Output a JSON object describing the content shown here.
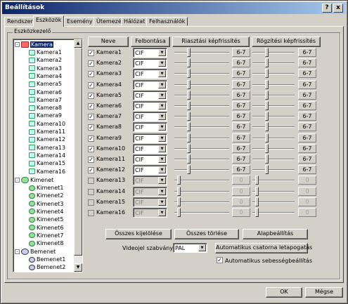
{
  "window": {
    "title": "Beállítások",
    "help_label": "?",
    "close_label": "x"
  },
  "tabs": [
    "Rendszer",
    "Eszközök",
    "Esemény",
    "Ütemezés",
    "Hálózat",
    "Felhasználók"
  ],
  "group_label": "Eszközkezelő",
  "tree": {
    "root": "Kamera",
    "cameras": [
      "Kamera1",
      "Kamera2",
      "Kamera3",
      "Kamera4",
      "Kamera5",
      "Kamera6",
      "Kamera7",
      "Kamera8",
      "Kamera9",
      "Kamera10",
      "Kamera11",
      "Kamera12",
      "Kamera13",
      "Kamera14",
      "Kamera15",
      "Kamera16"
    ],
    "outputs_root": "Kimenet",
    "outputs": [
      "Kimenet1",
      "Kimenet2",
      "Kimenet3",
      "Kimenet4",
      "Kimenet5",
      "Kimenet6",
      "Kimenet7",
      "Kimenet8"
    ],
    "inputs_root": "Bemenet",
    "inputs": [
      "Bemenet1",
      "Bemenet2"
    ]
  },
  "headers": {
    "name": "Neve",
    "resolution": "Felbontása",
    "alarm_rate": "Riasztási képfrissítés",
    "record_rate": "Rögzítési képfrissítés"
  },
  "cameras": [
    {
      "name": "Kamera1",
      "checked": true,
      "res": "CIF",
      "alarm": "6-7",
      "record": "6-7"
    },
    {
      "name": "Kamera2",
      "checked": true,
      "res": "CIF",
      "alarm": "6-7",
      "record": "6-7"
    },
    {
      "name": "Kamera3",
      "checked": true,
      "res": "CIF",
      "alarm": "6-7",
      "record": "6-7"
    },
    {
      "name": "Kamera4",
      "checked": true,
      "res": "CIF",
      "alarm": "6-7",
      "record": "6-7"
    },
    {
      "name": "Kamera5",
      "checked": true,
      "res": "CIF",
      "alarm": "6-7",
      "record": "6-7"
    },
    {
      "name": "Kamera6",
      "checked": true,
      "res": "CIF",
      "alarm": "6-7",
      "record": "6-7"
    },
    {
      "name": "Kamera7",
      "checked": true,
      "res": "CIF",
      "alarm": "6-7",
      "record": "6-7"
    },
    {
      "name": "Kamera8",
      "checked": true,
      "res": "CIF",
      "alarm": "6-7",
      "record": "6-7"
    },
    {
      "name": "Kamera9",
      "checked": true,
      "res": "CIF",
      "alarm": "6-7",
      "record": "6-7"
    },
    {
      "name": "Kamera10",
      "checked": true,
      "res": "CIF",
      "alarm": "6-7",
      "record": "6-7"
    },
    {
      "name": "Kamera11",
      "checked": true,
      "res": "CIF",
      "alarm": "6-7",
      "record": "6-7"
    },
    {
      "name": "Kamera12",
      "checked": true,
      "res": "CIF",
      "alarm": "6-7",
      "record": "6-7"
    },
    {
      "name": "Kamera13",
      "checked": false,
      "res": "CIF",
      "alarm": "0",
      "record": "0"
    },
    {
      "name": "Kamera14",
      "checked": false,
      "res": "CIF",
      "alarm": "0",
      "record": "0"
    },
    {
      "name": "Kamera15",
      "checked": false,
      "res": "CIF",
      "alarm": "0",
      "record": "0"
    },
    {
      "name": "Kamera16",
      "checked": false,
      "res": "CIF",
      "alarm": "0",
      "record": "0"
    }
  ],
  "buttons": {
    "select_all": "Összes kijelölése",
    "clear_all": "Összes törlése",
    "defaults": "Alapbeállítás",
    "auto_scan": "Automatikus csatorna letapogatás",
    "ok": "OK",
    "cancel": "Mégse"
  },
  "video_standard": {
    "label": "Videojel szabvány :",
    "value": "PAL"
  },
  "auto_speed": {
    "label": "Automatikus sebességbeállítás",
    "checked": true
  }
}
